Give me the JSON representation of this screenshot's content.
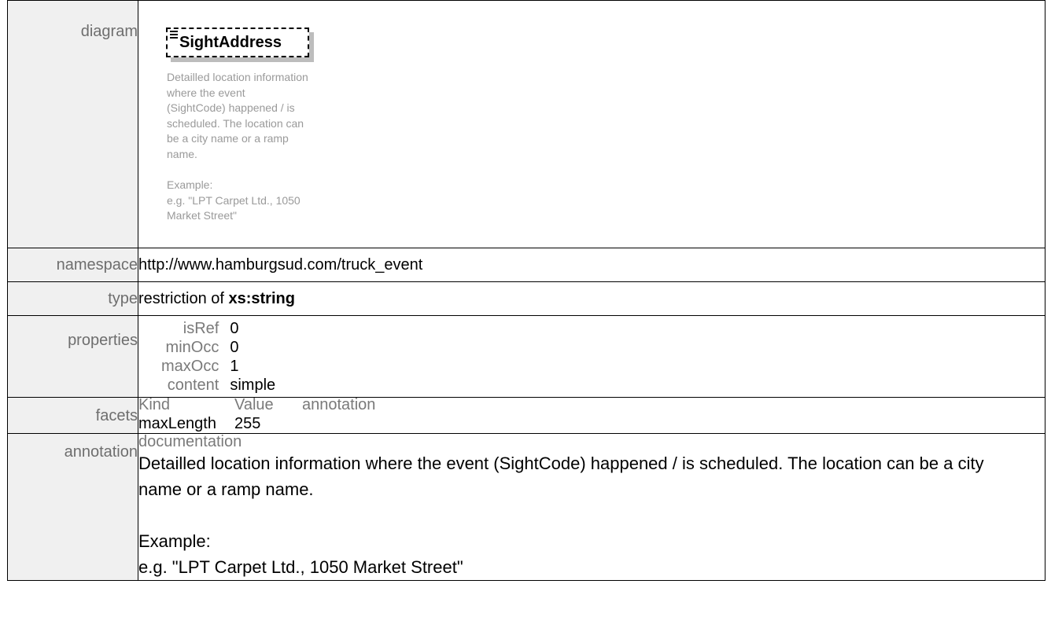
{
  "rows": {
    "diagram": {
      "label": "diagram",
      "element_name": "SightAddress",
      "doc_text": "Detailled location information\nwhere the event\n(SightCode) happened / is\nscheduled. The location can\nbe a city name or a ramp\nname.\n\nExample:\ne.g. \"LPT Carpet Ltd., 1050\nMarket Street\""
    },
    "namespace": {
      "label": "namespace",
      "value": "http://www.hamburgsud.com/truck_event"
    },
    "type": {
      "label": "type",
      "prefix": "restriction of ",
      "base": "xs:string"
    },
    "properties": {
      "label": "properties",
      "items": [
        {
          "key": "isRef",
          "value": "0"
        },
        {
          "key": "minOcc",
          "value": "0"
        },
        {
          "key": "maxOcc",
          "value": "1"
        },
        {
          "key": "content",
          "value": "simple"
        }
      ]
    },
    "facets": {
      "label": "facets",
      "headers": [
        "Kind",
        "Value",
        "annotation"
      ],
      "rows": [
        {
          "kind": "maxLength",
          "value": "255",
          "annotation": ""
        }
      ]
    },
    "annotation": {
      "label": "annotation",
      "heading": "documentation",
      "text": "Detailled location information where the event (SightCode) happened / is scheduled. The location can be a city name or a ramp name.\n\nExample:\ne.g. \"LPT Carpet Ltd., 1050 Market Street\""
    }
  }
}
